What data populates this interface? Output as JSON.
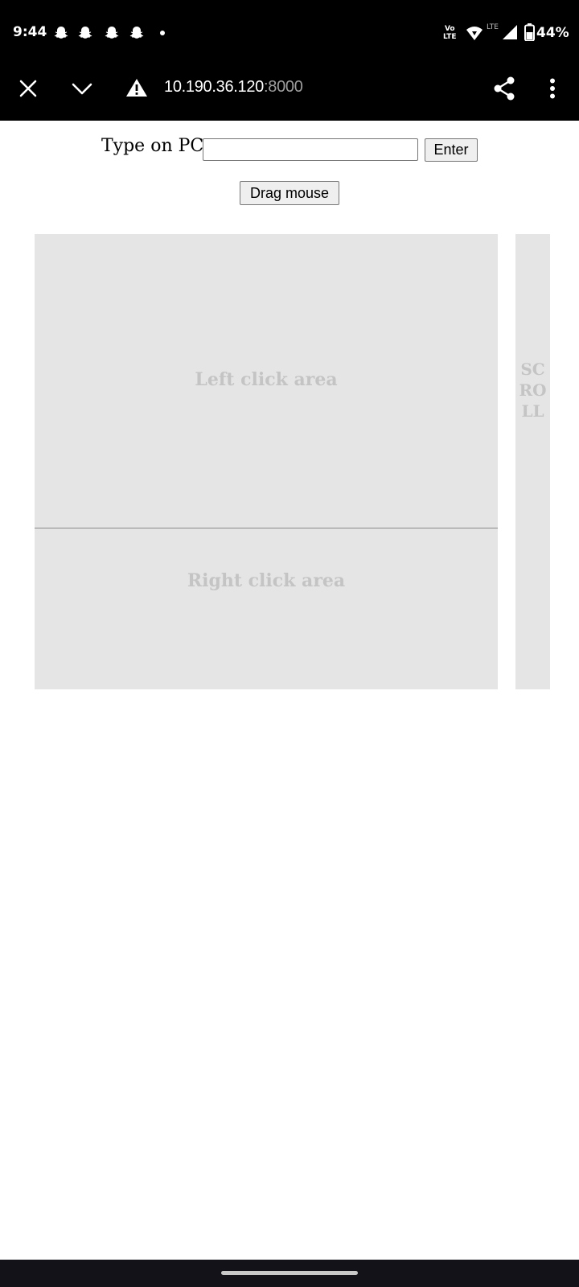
{
  "status_bar": {
    "time": "9:44",
    "notification_icons": [
      "snapchat-icon",
      "snapchat-icon",
      "snapchat-icon",
      "snapchat-icon"
    ],
    "network_label_top": "Vo",
    "network_label_bottom": "LTE",
    "lte_label": "LTE",
    "battery": "44%"
  },
  "browser": {
    "url_host": "10.190.36.120",
    "url_port": ":8000",
    "icons": [
      "close-icon",
      "chevron-down-icon",
      "warning-icon",
      "share-icon",
      "more-vert-icon"
    ]
  },
  "page": {
    "type_label": "Type on PC",
    "input_value": "",
    "enter_label": "Enter",
    "drag_label": "Drag mouse",
    "left_area_label": "Left click area",
    "right_area_label": "Right click area",
    "scroll_label": "SCROLL"
  },
  "colors": {
    "pad_background": "#e5e5e5",
    "pad_label": "#c4c4c4",
    "bar_background": "#000000"
  }
}
